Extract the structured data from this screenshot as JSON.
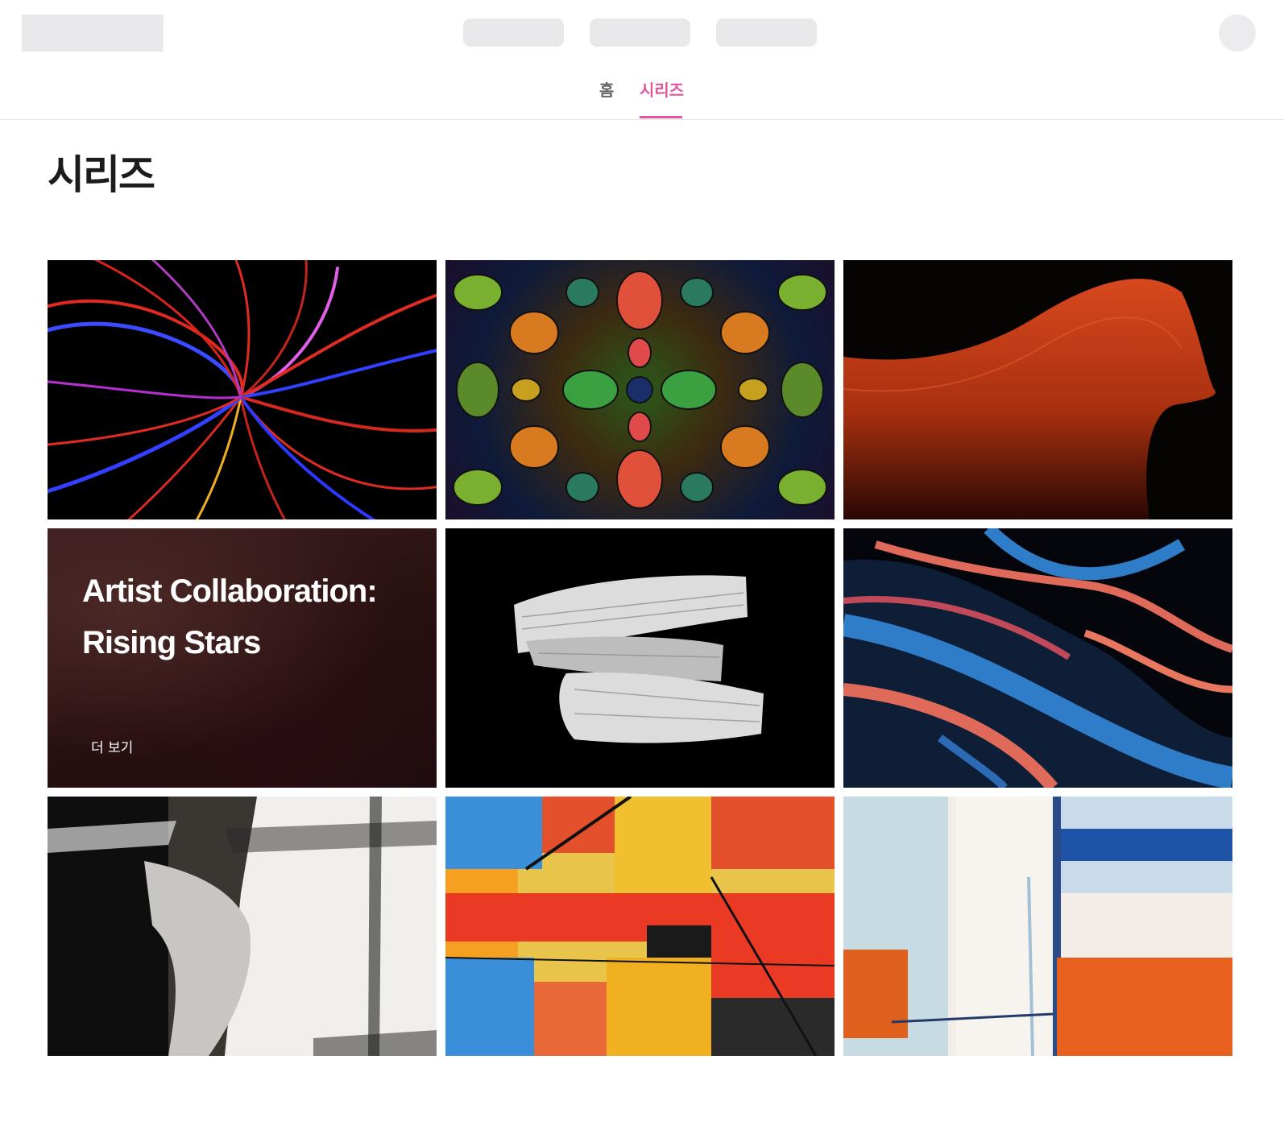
{
  "tabs": {
    "home": "홈",
    "series": "시리즈"
  },
  "page": {
    "title": "시리즈"
  },
  "feature_card": {
    "title": "Artist Collaboration: Rising Stars",
    "more_label": "더 보기"
  },
  "colors": {
    "accent": "#e0569f",
    "skeleton": "#e9e9ec"
  }
}
